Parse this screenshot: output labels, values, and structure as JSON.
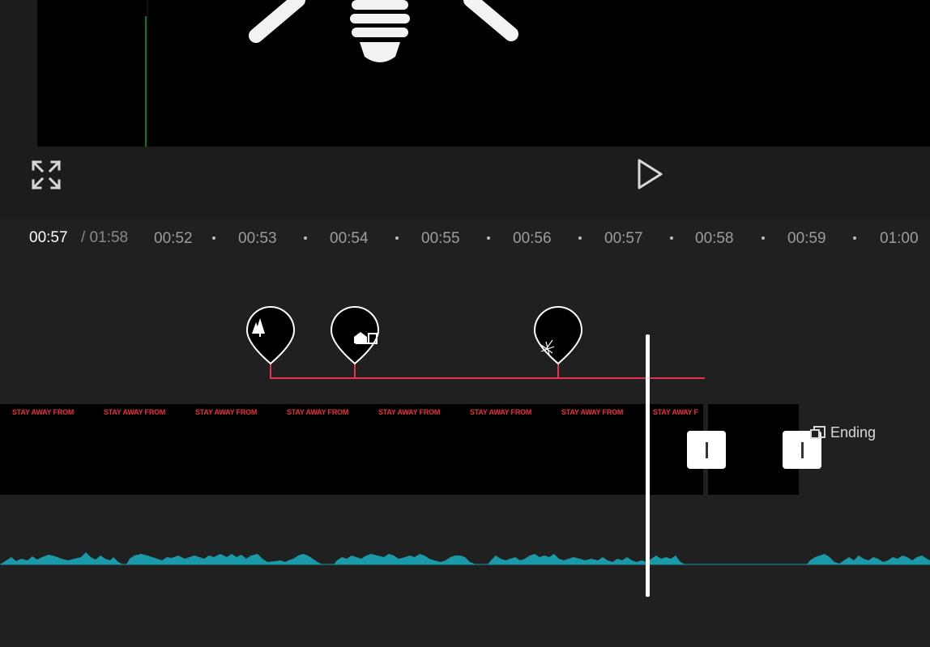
{
  "player": {
    "current_time": "00:57",
    "total_time": "/ 01:58"
  },
  "ruler": {
    "labels": [
      "00:52",
      "00:53",
      "00:54",
      "00:55",
      "00:56",
      "00:57",
      "00:58",
      "00:59",
      "01:00"
    ]
  },
  "clip": {
    "caption": "STAY AWAY FROM",
    "caption_partial": "STAY AWAY F"
  },
  "ending": {
    "label": "Ending"
  },
  "icons": {
    "fullscreen": "fullscreen-expand-icon",
    "play": "play-icon",
    "markers": [
      "trees-icon",
      "house-icon",
      "sparkle-icon"
    ],
    "ending": "ending-card-icon"
  },
  "colors": {
    "background": "#202020",
    "marker_line": "#e8304f",
    "caption": "#e83040",
    "waveform": "#1a9aa8"
  }
}
